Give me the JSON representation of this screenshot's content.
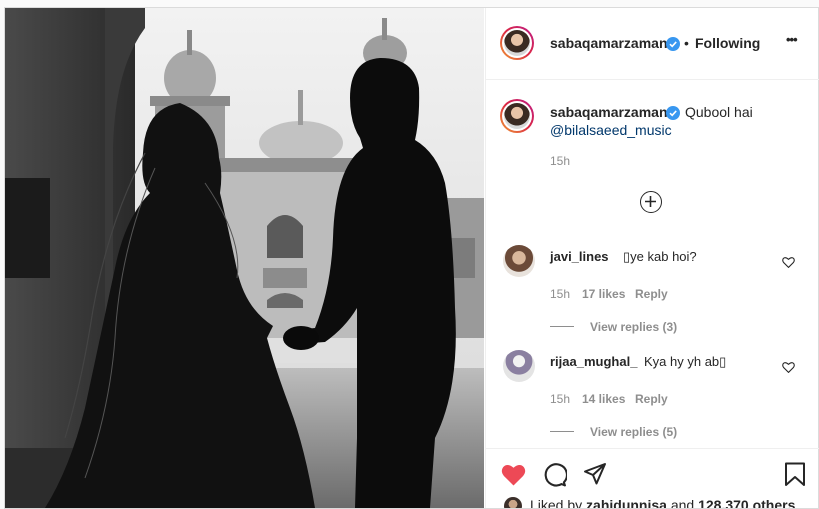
{
  "header": {
    "username": "sabaqamarzaman",
    "separator": "•",
    "follow_status": "Following",
    "more": "•••"
  },
  "caption": {
    "username": "sabaqamarzaman",
    "text": "Qubool hai",
    "mention": "@bilalsaeed_music",
    "time": "15h"
  },
  "load_more": "+",
  "comments": [
    {
      "username": "javi_lines",
      "text": "▯ye kab hoi?",
      "time": "15h",
      "likes": "17 likes",
      "reply": "Reply",
      "view_replies": "View replies (3)"
    },
    {
      "username": "rijaa_mughal_",
      "text": "Kya hy yh ab▯",
      "time": "15h",
      "likes": "14 likes",
      "reply": "Reply",
      "view_replies": "View replies (5)"
    }
  ],
  "liked_by": {
    "prefix": "Liked by ",
    "user": "zahidunnisa",
    "middle": " and ",
    "others": "128,370 others"
  },
  "colors": {
    "like": "#ed4956",
    "link": "#00376b",
    "verified": "#3897f0"
  }
}
